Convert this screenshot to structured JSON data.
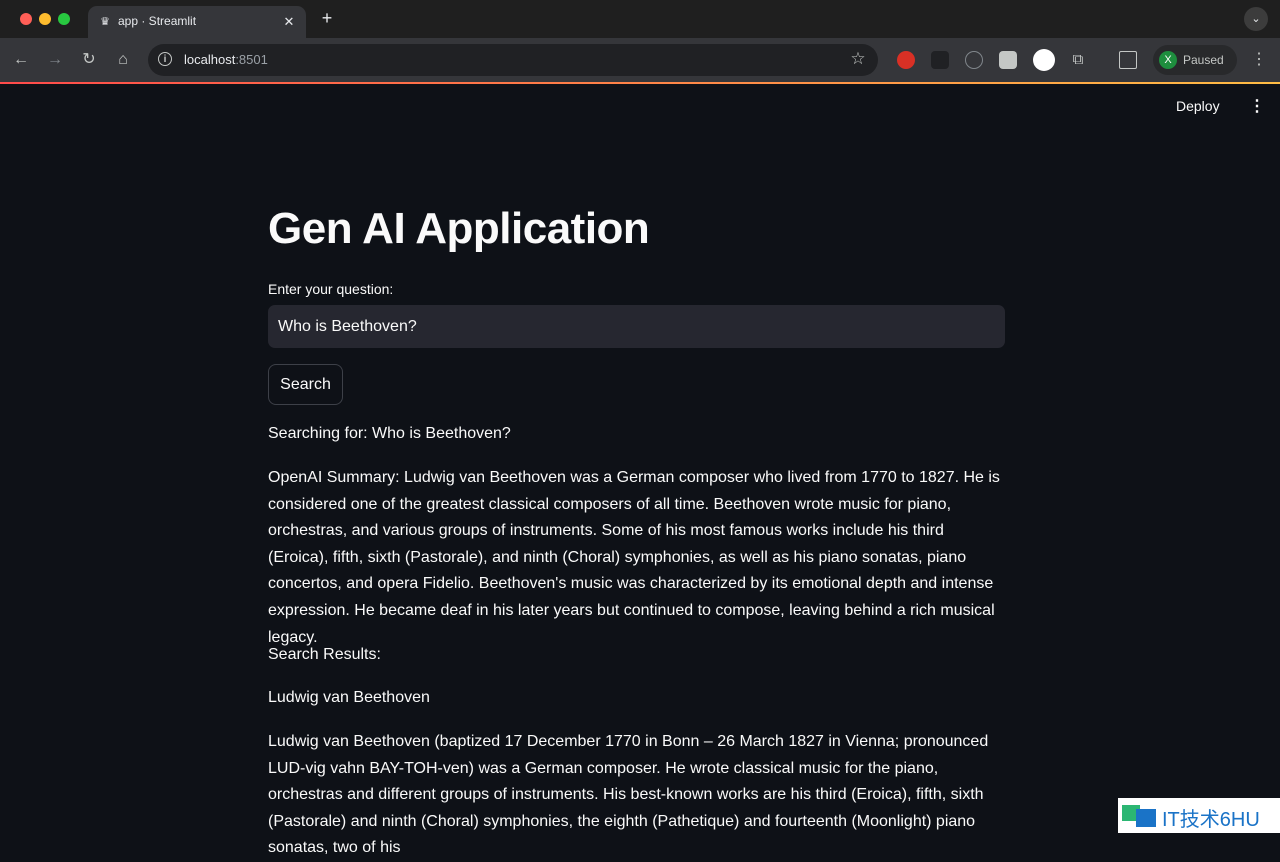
{
  "browser": {
    "tab_title": "app · Streamlit",
    "url_host": "localhost",
    "url_port": ":8501",
    "profile_initial": "X",
    "profile_status": "Paused"
  },
  "header": {
    "deploy_label": "Deploy"
  },
  "main": {
    "title": "Gen AI Application",
    "question_label": "Enter your question:",
    "question_value": "Who is Beethoven?",
    "search_button": "Search",
    "searching_text": "Searching for: Who is Beethoven?",
    "summary_text": "OpenAI Summary: Ludwig van Beethoven was a German composer who lived from 1770 to 1827. He is considered one of the greatest classical composers of all time. Beethoven wrote music for piano, orchestras, and various groups of instruments. Some of his most famous works include his third (Eroica), fifth, sixth (Pastorale), and ninth (Choral) symphonies, as well as his piano sonatas, piano concertos, and opera Fidelio. Beethoven's music was characterized by its emotional depth and intense expression. He became deaf in his later years but continued to compose, leaving behind a rich musical legacy.",
    "results_heading": "Search Results:",
    "result_title": "Ludwig van Beethoven",
    "result_text": "Ludwig van Beethoven (baptized 17 December 1770 in Bonn – 26 March 1827 in Vienna; pronounced LUD-vig vahn BAY-TOH-ven) was a German composer. He wrote classical music for the piano, orchestras and different groups of instruments. His best-known works are his third (Eroica), fifth, sixth (Pastorale) and ninth (Choral) symphonies, the eighth (Pathetique) and fourteenth (Moonlight) piano sonatas, two of his"
  },
  "watermark": {
    "text": "IT技术6HU"
  },
  "colors": {
    "app_background": "#0e1117",
    "input_background": "#262730",
    "text": "#fafafa"
  }
}
